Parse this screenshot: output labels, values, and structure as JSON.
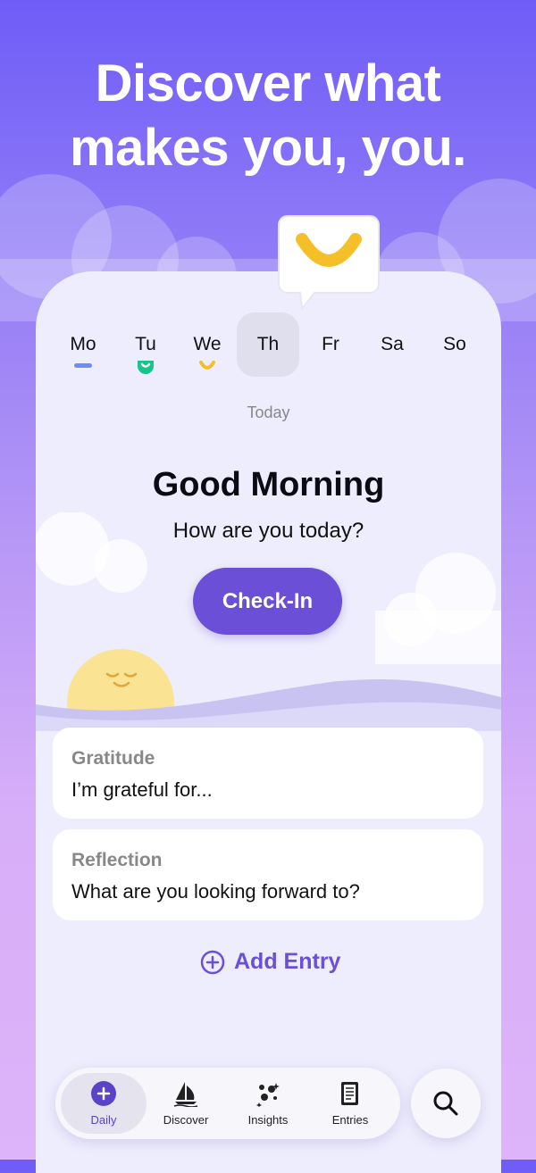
{
  "headline": {
    "line1": "Discover what",
    "line2": "makes you, you."
  },
  "days": [
    {
      "label": "Mo",
      "mood": "flat",
      "color": "#6b8ef2"
    },
    {
      "label": "Tu",
      "mood": "happy",
      "color": "#19c48a"
    },
    {
      "label": "We",
      "mood": "smile",
      "color": "#f5bf27"
    },
    {
      "label": "Th",
      "mood": "",
      "color": ""
    },
    {
      "label": "Fr",
      "mood": "",
      "color": ""
    },
    {
      "label": "Sa",
      "mood": "",
      "color": ""
    },
    {
      "label": "So",
      "mood": "",
      "color": ""
    }
  ],
  "selected_day": "Th",
  "today_label": "Today",
  "greeting": "Good Morning",
  "question": "How are you today?",
  "checkin_label": "Check-In",
  "cards": [
    {
      "title": "Gratitude",
      "text": "I’m grateful for..."
    },
    {
      "title": "Reflection",
      "text": "What are you looking forward to?"
    }
  ],
  "add_entry_label": "Add Entry",
  "tabs": [
    {
      "label": "Daily",
      "icon": "plus-circle-icon"
    },
    {
      "label": "Discover",
      "icon": "sailboat-icon"
    },
    {
      "label": "Insights",
      "icon": "sparkle-dots-icon"
    },
    {
      "label": "Entries",
      "icon": "journal-icon"
    }
  ],
  "active_tab": "Daily",
  "colors": {
    "accent": "#6b4fd6",
    "mood_yellow": "#f5bf27"
  }
}
